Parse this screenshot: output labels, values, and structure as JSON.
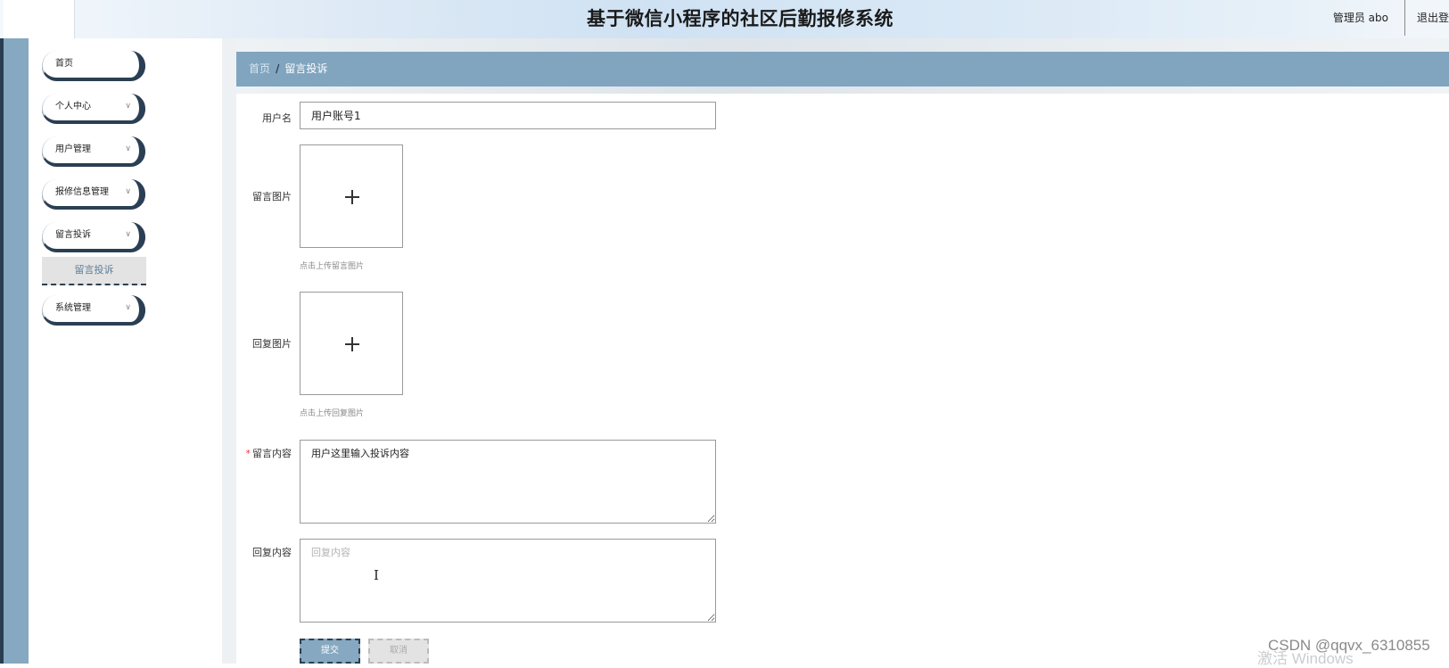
{
  "header": {
    "title": "基于微信小程序的社区后勤报修系统",
    "user": "管理员 abo",
    "logout": "退出登录"
  },
  "sidebar": {
    "items": [
      {
        "label": "首页",
        "has_children": false
      },
      {
        "label": "个人中心",
        "has_children": true
      },
      {
        "label": "用户管理",
        "has_children": true
      },
      {
        "label": "报修信息管理",
        "has_children": true
      },
      {
        "label": "留言投诉",
        "has_children": true
      },
      {
        "label": "系统管理",
        "has_children": true
      }
    ],
    "sub_item": "留言投诉",
    "chevron": "∨"
  },
  "breadcrumb": {
    "home": "首页",
    "separator": "/",
    "current": "留言投诉"
  },
  "form": {
    "username_label": "用户名",
    "username_value": "用户账号1",
    "message_image_label": "留言图片",
    "message_image_hint": "点击上传留言图片",
    "reply_image_label": "回复图片",
    "reply_image_hint": "点击上传回复图片",
    "message_content_label": "留言内容",
    "message_content_value": "用户这里输入投诉内容",
    "reply_content_label": "回复内容",
    "reply_content_placeholder": "回复内容",
    "required_mark": "*",
    "submit_label": "提交",
    "cancel_label": "取消"
  },
  "overlay": {
    "watermark": "CSDN @qqvx_6310855",
    "os_text": "激活 Windows"
  },
  "colors": {
    "accent": "#81a5bf",
    "dark": "#2b3f54",
    "required": "#e23b3b"
  },
  "icons": {
    "upload": "plus-icon",
    "text_cursor": "text-cursor-icon",
    "dropdown": "chevron-down-icon"
  }
}
